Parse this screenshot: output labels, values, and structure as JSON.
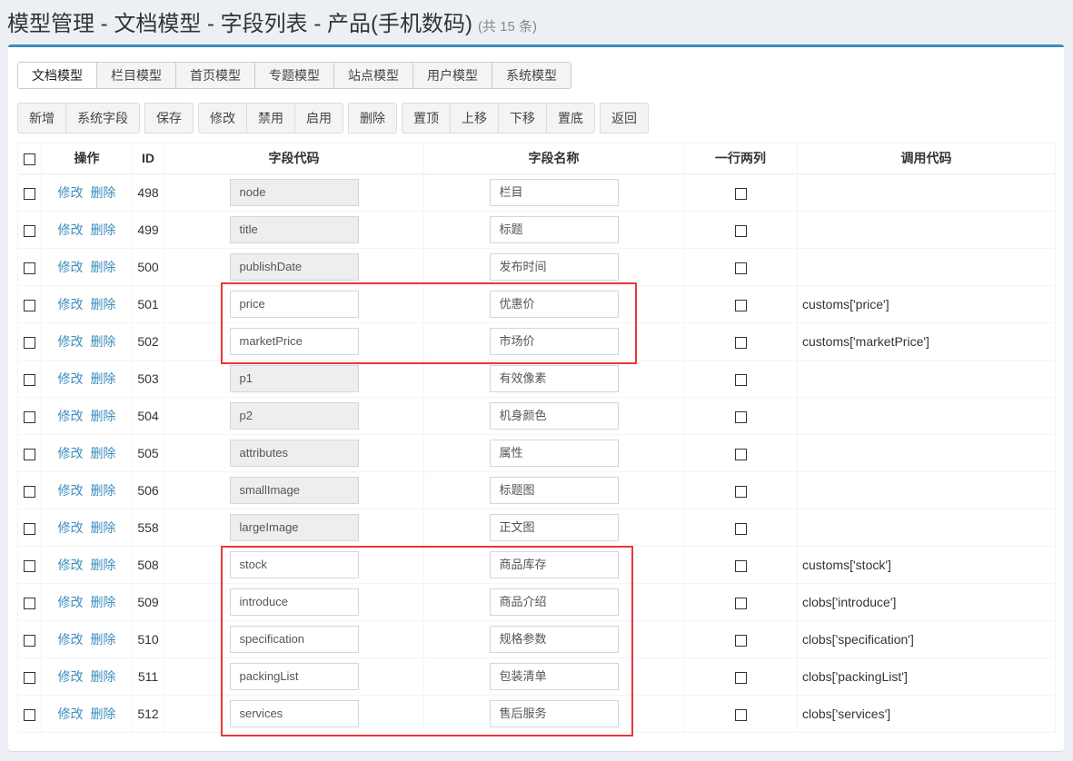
{
  "page": {
    "title": "模型管理 - 文档模型 - 字段列表 - 产品(手机数码)",
    "count": "(共 15 条)"
  },
  "tabs": [
    {
      "label": "文档模型",
      "active": true
    },
    {
      "label": "栏目模型",
      "active": false
    },
    {
      "label": "首页模型",
      "active": false
    },
    {
      "label": "专题模型",
      "active": false
    },
    {
      "label": "站点模型",
      "active": false
    },
    {
      "label": "用户模型",
      "active": false
    },
    {
      "label": "系统模型",
      "active": false
    }
  ],
  "toolbar": {
    "groups": [
      [
        "新增",
        "系统字段"
      ],
      [
        "保存"
      ],
      [
        "修改",
        "禁用",
        "启用"
      ],
      [
        "删除"
      ],
      [
        "置顶",
        "上移",
        "下移",
        "置底"
      ],
      [
        "返回"
      ]
    ]
  },
  "table": {
    "headers": {
      "actions": "操作",
      "id": "ID",
      "code": "字段代码",
      "name": "字段名称",
      "double_col": "一行两列",
      "call": "调用代码"
    },
    "edit_label": "修改",
    "delete_label": "删除",
    "rows": [
      {
        "id": "498",
        "code": "node",
        "readonly": true,
        "name": "栏目",
        "call": ""
      },
      {
        "id": "499",
        "code": "title",
        "readonly": true,
        "name": "标题",
        "call": ""
      },
      {
        "id": "500",
        "code": "publishDate",
        "readonly": true,
        "name": "发布时间",
        "call": ""
      },
      {
        "id": "501",
        "code": "price",
        "readonly": false,
        "name": "优惠价",
        "call": "customs['price']"
      },
      {
        "id": "502",
        "code": "marketPrice",
        "readonly": false,
        "name": "市场价",
        "call": "customs['marketPrice']"
      },
      {
        "id": "503",
        "code": "p1",
        "readonly": true,
        "name": "有效像素",
        "call": ""
      },
      {
        "id": "504",
        "code": "p2",
        "readonly": true,
        "name": "机身颜色",
        "call": ""
      },
      {
        "id": "505",
        "code": "attributes",
        "readonly": true,
        "name": "属性",
        "call": ""
      },
      {
        "id": "506",
        "code": "smallImage",
        "readonly": true,
        "name": "标题图",
        "call": ""
      },
      {
        "id": "558",
        "code": "largeImage",
        "readonly": true,
        "name": "正文图",
        "call": ""
      },
      {
        "id": "508",
        "code": "stock",
        "readonly": false,
        "name": "商品库存",
        "call": "customs['stock']"
      },
      {
        "id": "509",
        "code": "introduce",
        "readonly": false,
        "name": "商品介绍",
        "call": "clobs['introduce']"
      },
      {
        "id": "510",
        "code": "specification",
        "readonly": false,
        "name": "规格参数",
        "call": "clobs['specification']"
      },
      {
        "id": "511",
        "code": "packingList",
        "readonly": false,
        "name": "包装清单",
        "call": "clobs['packingList']"
      },
      {
        "id": "512",
        "code": "services",
        "readonly": false,
        "name": "售后服务",
        "call": "clobs['services']"
      }
    ]
  },
  "highlight_color": "#e8373a",
  "accent_color": "#3c8dbc"
}
